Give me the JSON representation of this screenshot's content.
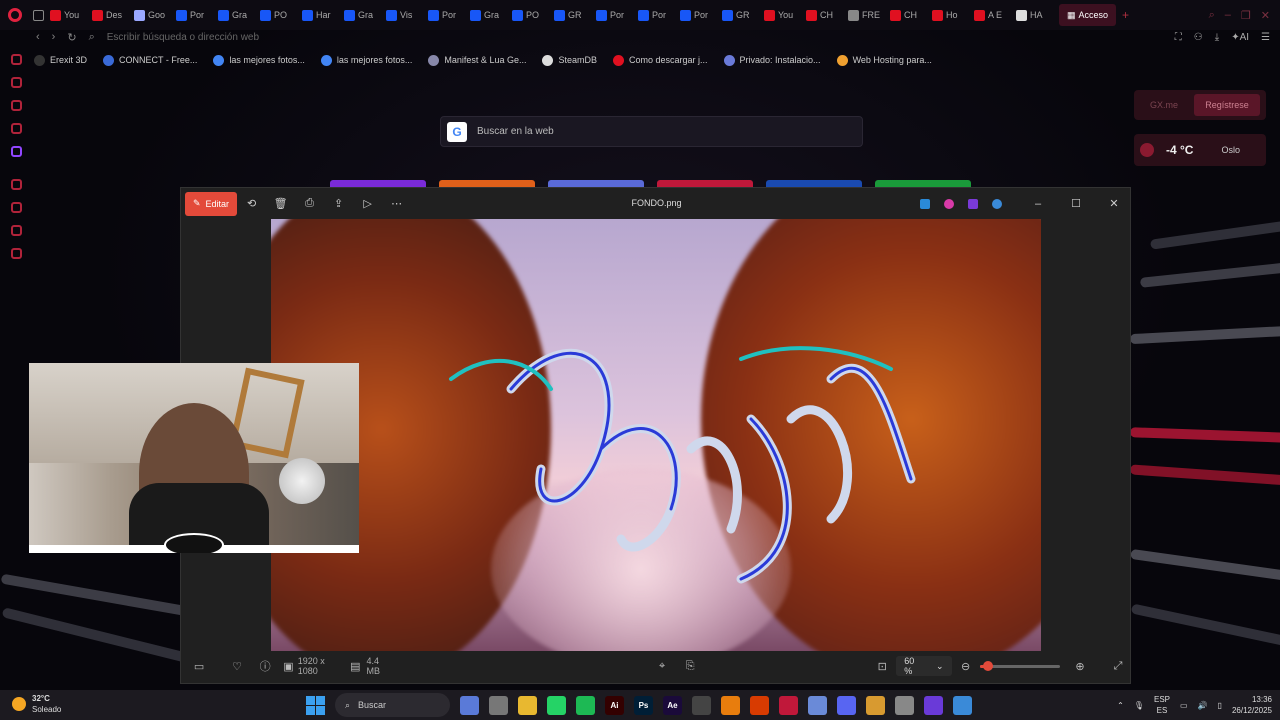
{
  "colors": {
    "accent": "#e0223f",
    "edit": "#e34a3a"
  },
  "browser": {
    "tabs": [
      {
        "label": "You",
        "icon": "youtube-icon",
        "color": "#e01020"
      },
      {
        "label": "Des",
        "icon": "youtube-icon",
        "color": "#e01020"
      },
      {
        "label": "Goo",
        "icon": "gemini-icon",
        "color": "#9aa8ff"
      },
      {
        "label": "Por",
        "icon": "behance-icon",
        "color": "#1857f7"
      },
      {
        "label": "Gra",
        "icon": "behance-icon",
        "color": "#1857f7"
      },
      {
        "label": "PO",
        "icon": "behance-icon",
        "color": "#1857f7"
      },
      {
        "label": "Har",
        "icon": "behance-icon",
        "color": "#1857f7"
      },
      {
        "label": "Gra",
        "icon": "behance-icon",
        "color": "#1857f7"
      },
      {
        "label": "Vis",
        "icon": "behance-icon",
        "color": "#1857f7"
      },
      {
        "label": "Por",
        "icon": "behance-icon",
        "color": "#1857f7"
      },
      {
        "label": "Gra",
        "icon": "behance-icon",
        "color": "#1857f7"
      },
      {
        "label": "PO",
        "icon": "behance-icon",
        "color": "#1857f7"
      },
      {
        "label": "GR",
        "icon": "behance-icon",
        "color": "#1857f7"
      },
      {
        "label": "Por",
        "icon": "behance-icon",
        "color": "#1857f7"
      },
      {
        "label": "Por",
        "icon": "behance-icon",
        "color": "#1857f7"
      },
      {
        "label": "Por",
        "icon": "behance-icon",
        "color": "#1857f7"
      },
      {
        "label": "GR",
        "icon": "behance-icon",
        "color": "#1857f7"
      },
      {
        "label": "You",
        "icon": "youtube-icon",
        "color": "#e01020"
      },
      {
        "label": "CH",
        "icon": "youtube-icon",
        "color": "#e01020"
      },
      {
        "label": "FRE",
        "icon": "site-icon",
        "color": "#888888"
      },
      {
        "label": "CH",
        "icon": "youtube-icon",
        "color": "#e01020"
      },
      {
        "label": "Ho",
        "icon": "youtube-icon",
        "color": "#e01020"
      },
      {
        "label": "A E",
        "icon": "youtube-icon",
        "color": "#e01020"
      },
      {
        "label": "HA",
        "icon": "chat-icon",
        "color": "#dddddd"
      }
    ],
    "active_tab": "Acceso",
    "new_tab": "+",
    "address_placeholder": "Escribir búsqueda o dirección web",
    "ai_label": "AI",
    "bookmarks": [
      {
        "label": "Erexit 3D",
        "color": "#333333"
      },
      {
        "label": "CONNECT - Free...",
        "color": "#3a6ad8"
      },
      {
        "label": "las mejores fotos...",
        "color": "#4285f4"
      },
      {
        "label": "las mejores fotos...",
        "color": "#4285f4"
      },
      {
        "label": "Manifest & Lua Ge...",
        "color": "#8888aa"
      },
      {
        "label": "SteamDB",
        "color": "#dddddd"
      },
      {
        "label": "Como descargar j...",
        "color": "#e01020"
      },
      {
        "label": "Privado: Instalacio...",
        "color": "#6a7ad8"
      },
      {
        "label": "Web Hosting para...",
        "color": "#f0a030"
      }
    ]
  },
  "speed_dial": {
    "search_placeholder": "Buscar en la web",
    "google_letter": "G",
    "tile_colors": [
      "#7a2ad8",
      "#e0601a",
      "#5a6ad8",
      "#c0183a",
      "#1a4ab0",
      "#1a9a3a"
    ]
  },
  "widgets": {
    "gx_me": "GX.me",
    "register": "Regístrese",
    "temperature": "-4 °C",
    "city": "Oslo"
  },
  "viewer": {
    "edit_label": "Editar",
    "file_name": "FONDO.png",
    "dimensions": "1920 x 1080",
    "file_size": "4.4 MB",
    "zoom": "60 %",
    "zoom_fraction": 0.1
  },
  "taskbar": {
    "weather_temp": "32°C",
    "weather_desc": "Soleado",
    "search": "Buscar",
    "lang_top": "ESP",
    "lang_bottom": "ES",
    "time": "13:36",
    "date": "26/12/2025",
    "apps": [
      {
        "name": "widget-icon",
        "color": "#5a7ad8",
        "label": ""
      },
      {
        "name": "task-view-icon",
        "color": "#777777",
        "label": ""
      },
      {
        "name": "file-explorer-icon",
        "color": "#e8b830",
        "label": ""
      },
      {
        "name": "whatsapp-icon",
        "color": "#25d366",
        "label": ""
      },
      {
        "name": "spotify-icon",
        "color": "#1db954",
        "label": ""
      },
      {
        "name": "illustrator-icon",
        "color": "#330000",
        "label": "Ai"
      },
      {
        "name": "photoshop-icon",
        "color": "#001e36",
        "label": "Ps"
      },
      {
        "name": "after-effects-icon",
        "color": "#1a0a3a",
        "label": "Ae"
      },
      {
        "name": "store-icon",
        "color": "#444444",
        "label": ""
      },
      {
        "name": "blender-icon",
        "color": "#e87d0d",
        "label": ""
      },
      {
        "name": "office-icon",
        "color": "#d83b01",
        "label": ""
      },
      {
        "name": "opera-gx-icon",
        "color": "#c0183a",
        "label": ""
      },
      {
        "name": "app-icon",
        "color": "#6a8ad8",
        "label": ""
      },
      {
        "name": "discord-icon",
        "color": "#5865f2",
        "label": ""
      },
      {
        "name": "app2-icon",
        "color": "#d89a30",
        "label": ""
      },
      {
        "name": "chrome-icon",
        "color": "#888888",
        "label": ""
      },
      {
        "name": "app3-icon",
        "color": "#6a3ad8",
        "label": ""
      },
      {
        "name": "photos-icon",
        "color": "#3a8ad8",
        "label": ""
      }
    ]
  }
}
